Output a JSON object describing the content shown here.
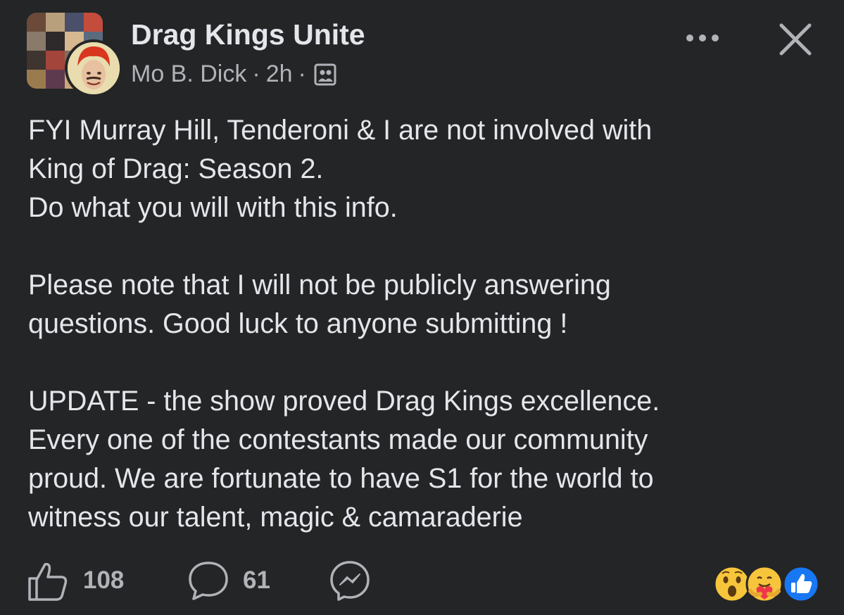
{
  "header": {
    "group_name": "Drag Kings Unite",
    "author": "Mo B. Dick",
    "separator": "·",
    "time_ago": "2h",
    "audience_icon": "group-members-icon",
    "more_icon": "more-dots-icon",
    "close_icon": "close-icon"
  },
  "post": {
    "paragraphs": [
      [
        "FYI Murray Hill, Tenderoni & I are not involved with",
        "King of Drag: Season 2.",
        "Do what you will with this info."
      ],
      [
        "Please note that I will not be publicly answering",
        "questions. Good luck to anyone submitting !"
      ],
      [
        "UPDATE - the show proved Drag Kings excellence.",
        "Every one of the contestants made our community",
        "proud. We are fortunate to have S1 for the world to",
        "witness our talent, magic & camaraderie"
      ]
    ]
  },
  "footer": {
    "like_count": "108",
    "comment_count": "61",
    "like_icon": "thumbs-up-outline-icon",
    "comment_icon": "comment-bubble-icon",
    "share_icon": "messenger-icon",
    "reactions": [
      "wow-reaction-icon",
      "care-reaction-icon",
      "like-reaction-icon"
    ]
  },
  "colors": {
    "background": "#242526",
    "primary_text": "#e4e6eb",
    "secondary_text": "#b0b3b8",
    "like_blue": "#1877f2",
    "reaction_yellow": "#f7c53c"
  }
}
